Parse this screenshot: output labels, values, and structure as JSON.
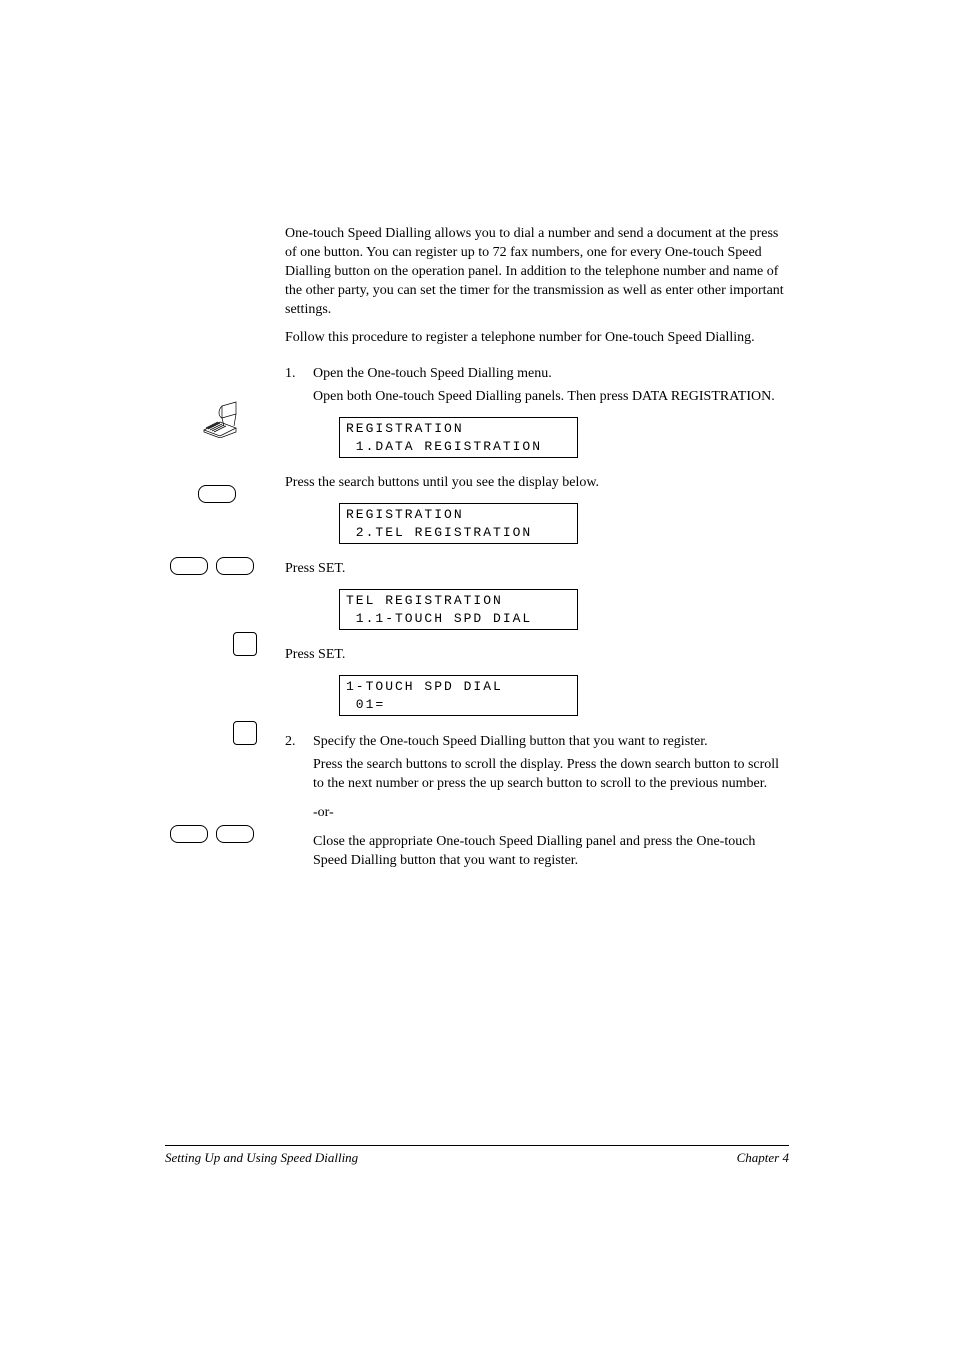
{
  "intro": {
    "p1": "One-touch Speed Dialling allows you to dial a number and send a document at the press of one button. You can register up to 72 fax numbers, one for every One-touch Speed Dialling button on the operation panel. In addition to the telephone number and name of the other party, you can set the timer for the transmission as well as enter other important settings.",
    "p2": "Follow this procedure to register a telephone number for One-touch Speed Dialling."
  },
  "step1": {
    "num": "1.",
    "title": "Open the One-touch Speed Dialling menu.",
    "sub1": "Open both One-touch Speed Dialling panels. Then press DATA REGISTRATION.",
    "lcd1_l1": "REGISTRATION",
    "lcd1_l2": " 1.DATA REGISTRATION",
    "sub2": "Press the search buttons until you see the display below.",
    "lcd2_l1": "REGISTRATION",
    "lcd2_l2": " 2.TEL REGISTRATION",
    "sub3": "Press SET.",
    "lcd3_l1": "TEL REGISTRATION",
    "lcd3_l2": " 1.1-TOUCH SPD DIAL",
    "sub4": "Press SET.",
    "lcd4_l1": "1-TOUCH SPD DIAL",
    "lcd4_l2": " 01="
  },
  "step2": {
    "num": "2.",
    "title": "Specify the One-touch Speed Dialling button that you want to register.",
    "sub1": "Press the search buttons to scroll the display. Press the down search button to scroll to the next number or press the up search button to scroll to the previous number.",
    "or": "-or-",
    "sub2": "Close the appropriate One-touch Speed Dialling panel and press the One-touch Speed Dialling button that you want to register."
  },
  "footer": {
    "left": "Setting Up and Using Speed Dialling",
    "right": "Chapter 4"
  }
}
